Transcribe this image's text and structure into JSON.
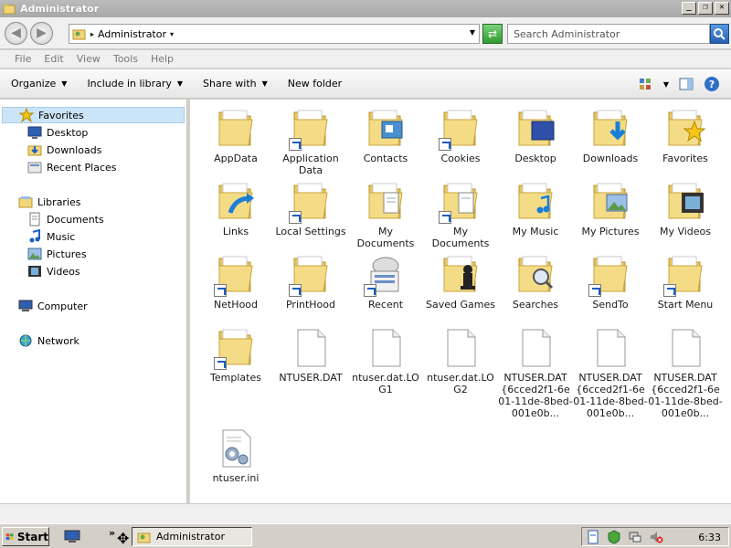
{
  "window": {
    "title": "Administrator"
  },
  "address": {
    "crumb": "Administrator",
    "search_placeholder": "Search Administrator"
  },
  "menu": {
    "items": [
      "File",
      "Edit",
      "View",
      "Tools",
      "Help"
    ]
  },
  "commands": {
    "organize": "Organize",
    "include": "Include in library",
    "share": "Share with",
    "new_folder": "New folder"
  },
  "nav": {
    "favorites": "Favorites",
    "desktop": "Desktop",
    "downloads": "Downloads",
    "recent": "Recent Places",
    "libraries": "Libraries",
    "documents": "Documents",
    "music": "Music",
    "pictures": "Pictures",
    "videos": "Videos",
    "computer": "Computer",
    "network": "Network"
  },
  "files": [
    "AppData",
    "Application Data",
    "Contacts",
    "Cookies",
    "Desktop",
    "Downloads",
    "Favorites",
    "Links",
    "Local Settings",
    "My Documents",
    "My Documents",
    "My Music",
    "My Pictures",
    "My Videos",
    "NetHood",
    "PrintHood",
    "Recent",
    "Saved Games",
    "Searches",
    "SendTo",
    "Start Menu",
    "Templates",
    "NTUSER.DAT",
    "ntuser.dat.LOG1",
    "ntuser.dat.LOG2",
    "NTUSER.DAT{6cced2f1-6e01-11de-8bed-001e0b...",
    "NTUSER.DAT{6cced2f1-6e01-11de-8bed-001e0b...",
    "NTUSER.DAT{6cced2f1-6e01-11de-8bed-001e0b...",
    "ntuser.ini"
  ],
  "taskbar": {
    "start": "Start",
    "task": "Administrator",
    "clock": "6:33"
  },
  "colors": {
    "folder": "#f2d77a",
    "accent": "#1b5fbf",
    "selection": "#cce4f7"
  }
}
